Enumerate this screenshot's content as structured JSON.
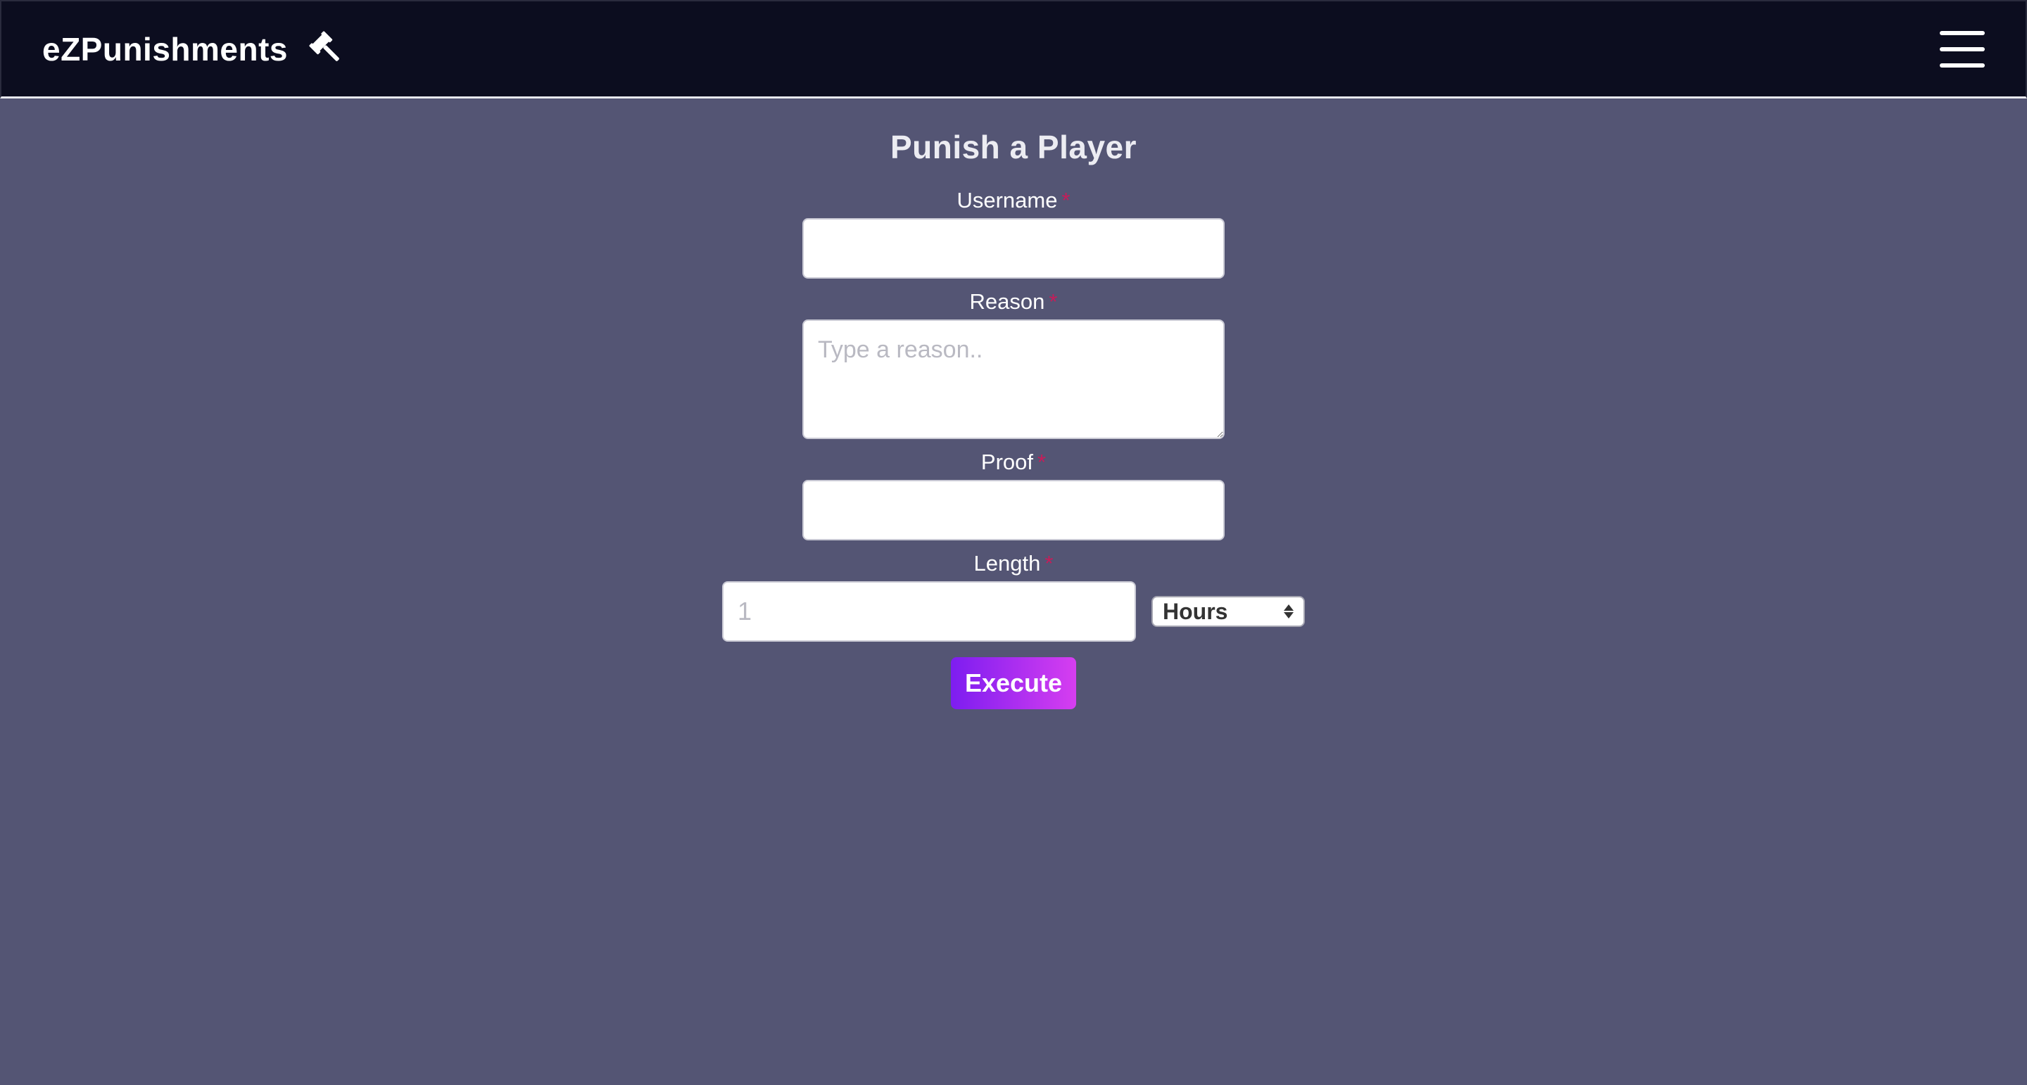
{
  "navbar": {
    "brand_title": "eZPunishments",
    "brand_icon": "gavel-icon",
    "menu_icon": "hamburger-menu-icon"
  },
  "form": {
    "title": "Punish a Player",
    "required_mark": "*",
    "username": {
      "label": "Username",
      "value": "",
      "placeholder": ""
    },
    "reason": {
      "label": "Reason",
      "value": "",
      "placeholder": "Type a reason.."
    },
    "proof": {
      "label": "Proof",
      "value": "",
      "placeholder": ""
    },
    "length": {
      "label": "Length",
      "value": "",
      "placeholder": "1",
      "unit_selected": "Hours"
    },
    "submit_label": "Execute"
  },
  "colors": {
    "page_background": "#545574",
    "navbar_background": "#0c0d1f",
    "required_mark": "#c61d5a",
    "button_gradient_start": "#7d1df0",
    "button_gradient_end": "#d63ef0"
  }
}
